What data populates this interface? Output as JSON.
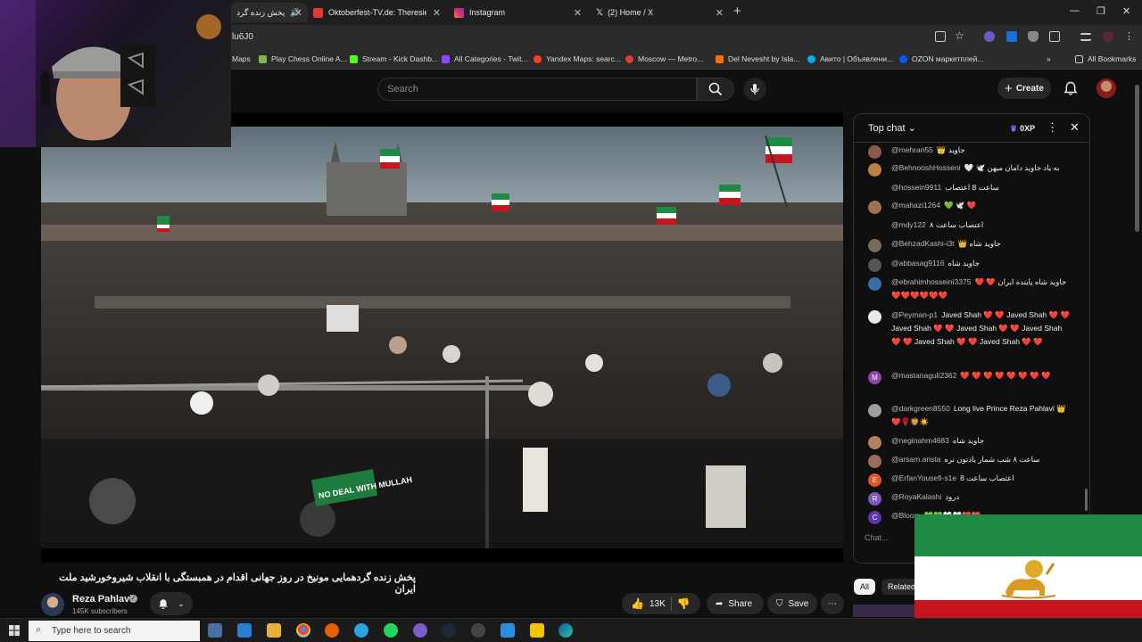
{
  "browser": {
    "tabs": [
      {
        "title": "پخش زنده گرد",
        "active": true,
        "color": "#d0d0d0"
      },
      {
        "title": "Oktoberfest-TV.de: Theresienw",
        "active": false,
        "color": "#e53935"
      },
      {
        "title": "Instagram",
        "active": false,
        "color": "#d6249f"
      },
      {
        "title": "(2) Home / X",
        "active": false,
        "color": "#000000"
      }
    ],
    "url_fragment": "lu6J0",
    "bookmarks": [
      {
        "label": "Maps",
        "color": "#4285f4"
      },
      {
        "label": "Play Chess Online A...",
        "color": "#81b64c"
      },
      {
        "label": "Stream - Kick Dashb...",
        "color": "#53fc18"
      },
      {
        "label": "All Categories - Twit...",
        "color": "#9146ff"
      },
      {
        "label": "Yandex Maps: searc...",
        "color": "#fc3f1d"
      },
      {
        "label": "Moscow — Metro...",
        "color": "#e53935"
      },
      {
        "label": "Del Nevesht by Isla...",
        "color": "#ff6f00"
      },
      {
        "label": "Авито | Объявлени...",
        "color": "#00aaff"
      },
      {
        "label": "OZON маркетплей...",
        "color": "#005bff"
      }
    ],
    "all_bookmarks": "All Bookmarks"
  },
  "header": {
    "search_placeholder": "Search",
    "create_label": "Create"
  },
  "video": {
    "title": "پخش زنده گردهمایی مونیخ در روز جهانی اقدام در همبستگی با انقلاب شیروخورشید ملت ایران",
    "sign_text": "NO DEAL WITH MULLAH"
  },
  "channel": {
    "name": "Reza Pahlavi",
    "subscribers": "145K subscribers"
  },
  "actions": {
    "likes": "13K",
    "share": "Share",
    "save": "Save"
  },
  "chat": {
    "mode": "Top chat",
    "xp": "0XP",
    "input_placeholder": "Chat...",
    "messages": [
      {
        "user": "@mehran55",
        "text": "👑 جاوید",
        "avatar_color": "#8a5a4a",
        "avatar_letter": ""
      },
      {
        "user": "@BehnooshHosseni",
        "text": "🤍 🕊️ به یاد جاوید دامان میهن",
        "avatar_color": "#c08040",
        "avatar_letter": ""
      },
      {
        "user": "@hossein9911",
        "text": "ساعت 8 اعتصاب",
        "avatar_color": "",
        "avatar_letter": ""
      },
      {
        "user": "@mahazi1264",
        "text": "💚 🕊️ ❤️",
        "avatar_color": "#a07050",
        "avatar_letter": ""
      },
      {
        "user": "@mdy122",
        "text": "اعتصاب ساعت ۸",
        "avatar_color": "",
        "avatar_letter": ""
      },
      {
        "user": "@BehzadKashi-i3t",
        "text": "👑 جاوید شاه",
        "avatar_color": "#7a6a5a",
        "avatar_letter": ""
      },
      {
        "user": "@abbasag9116",
        "text": "جاوید شاه",
        "avatar_color": "#555555",
        "avatar_letter": ""
      },
      {
        "user": "@ebrahimhosseini3375",
        "text": "❤️ ❤️ جاوید شاه پاینده ایران ❤️❤️❤️❤️❤️❤️",
        "avatar_color": "#3a6ea5",
        "avatar_letter": ""
      },
      {
        "user": "@Peyman-p1",
        "text": "Javed Shah ❤️ ❤️ Javed Shah ❤️ ❤️ Javed Shah ❤️ ❤️ Javed Shah ❤️ ❤️ Javed Shah ❤️ ❤️ Javed Shah ❤️ ❤️ Javed Shah ❤️ ❤️",
        "avatar_color": "#e8e8e8",
        "avatar_letter": ""
      },
      {
        "user": "@mastanaguli2362",
        "text": "❤️ ❤️ ❤️ ❤️ ❤️ ❤️ ❤️ ❤️",
        "avatar_color": "#8e44ad",
        "avatar_letter": "M"
      },
      {
        "user": "@darkgreen8550",
        "text": "Long live Prince Reza Pahlavi 👑❤️🌹🦁☀️",
        "avatar_color": "#9e9e9e",
        "avatar_letter": ""
      },
      {
        "user": "@neginahm4683",
        "text": "جاوید شاه",
        "avatar_color": "#b08060",
        "avatar_letter": ""
      },
      {
        "user": "@arsam.arista",
        "text": "ساعت ۸ شب شمار یادتون نره",
        "avatar_color": "#9a6a5a",
        "avatar_letter": ""
      },
      {
        "user": "@ErfanYousefi-s1e",
        "text": "8 اعتصاب ساعت",
        "avatar_color": "#e0552b",
        "avatar_letter": "E"
      },
      {
        "user": "@RoyaKalashi",
        "text": "درود",
        "avatar_color": "#7e57c2",
        "avatar_letter": "R"
      },
      {
        "user": "@Bloom",
        "text": "💚💚🤍🤍❤️❤️",
        "avatar_color": "#5e35b1",
        "avatar_letter": "C"
      }
    ]
  },
  "chips": {
    "all": "All",
    "related": "Related"
  },
  "taskbar": {
    "search_placeholder": "Type here to search"
  }
}
